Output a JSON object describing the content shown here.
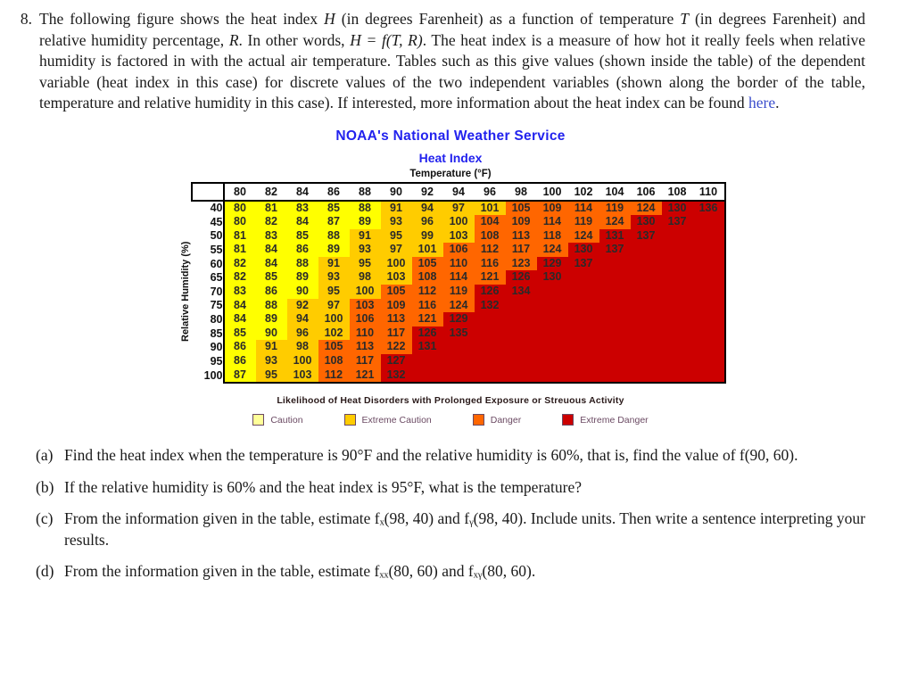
{
  "problem": {
    "number": "8.",
    "text_parts": [
      {
        "t": "The following figure shows the heat index "
      },
      {
        "t": "H",
        "style": "italic"
      },
      {
        "t": " (in degrees Farenheit) as a function of temperature "
      },
      {
        "t": "T",
        "style": "italic"
      },
      {
        "t": " (in degrees Farenheit) and relative humidity percentage, "
      },
      {
        "t": "R",
        "style": "italic"
      },
      {
        "t": ". In other words, "
      },
      {
        "t": "H = f(T, R)",
        "style": "italic"
      },
      {
        "t": ". The heat index is a measure of how hot it really feels when relative humidity is factored in with the actual air temperature. Tables such as this give values (shown inside the table) of the dependent variable (heat index in this case) for discrete values of the two independent variables (shown along the border of the table, temperature and relative humidity in this case). If interested, more information about the heat index can be found "
      },
      {
        "t": "here",
        "style": "link"
      },
      {
        "t": "."
      }
    ],
    "full_text": "The following figure shows the heat index H (in degrees Farenheit) as a function of temperature T (in degrees Farenheit) and relative humidity percentage, R. In other words, H = f(T, R). The heat index is a measure of how hot it really feels when relative humidity is factored in with the actual air temperature. Tables such as this give values (shown inside the table) of the dependent variable (heat index in this case) for discrete values of the two independent variables (shown along the border of the table, temperature and relative humidity in this case). If interested, more information about the heat index can be found here.",
    "link_text": "here",
    "link_color": "#3b4ecc"
  },
  "figure": {
    "org_title": "NOAA's National Weather Service",
    "chart_title": "Heat Index",
    "x_axis_title": "Temperature (°F)",
    "y_axis_title": "Relative Humidity (%)",
    "title_color": "#2222ee"
  },
  "chart_data": {
    "type": "heatmap",
    "title": "Heat Index",
    "subtitle": "NOAA's National Weather Service",
    "xlabel": "Temperature (°F)",
    "ylabel": "Relative Humidity (%)",
    "grid": false,
    "legend_position": "bottom",
    "x": [
      80,
      82,
      84,
      86,
      88,
      90,
      92,
      94,
      96,
      98,
      100,
      102,
      104,
      106,
      108,
      110
    ],
    "y": [
      40,
      45,
      50,
      55,
      60,
      65,
      70,
      75,
      80,
      85,
      90,
      95,
      100
    ],
    "values": [
      [
        80,
        81,
        83,
        85,
        88,
        91,
        94,
        97,
        101,
        105,
        109,
        114,
        119,
        124,
        130,
        136
      ],
      [
        80,
        82,
        84,
        87,
        89,
        93,
        96,
        100,
        104,
        109,
        114,
        119,
        124,
        130,
        137,
        null
      ],
      [
        81,
        83,
        85,
        88,
        91,
        95,
        99,
        103,
        108,
        113,
        118,
        124,
        131,
        137,
        null,
        null
      ],
      [
        81,
        84,
        86,
        89,
        93,
        97,
        101,
        106,
        112,
        117,
        124,
        130,
        137,
        null,
        null,
        null
      ],
      [
        82,
        84,
        88,
        91,
        95,
        100,
        105,
        110,
        116,
        123,
        129,
        137,
        null,
        null,
        null,
        null
      ],
      [
        82,
        85,
        89,
        93,
        98,
        103,
        108,
        114,
        121,
        126,
        130,
        null,
        null,
        null,
        null,
        null
      ],
      [
        83,
        86,
        90,
        95,
        100,
        105,
        112,
        119,
        126,
        134,
        null,
        null,
        null,
        null,
        null,
        null
      ],
      [
        84,
        88,
        92,
        97,
        103,
        109,
        116,
        124,
        132,
        null,
        null,
        null,
        null,
        null,
        null,
        null
      ],
      [
        84,
        89,
        94,
        100,
        106,
        113,
        121,
        129,
        null,
        null,
        null,
        null,
        null,
        null,
        null,
        null
      ],
      [
        85,
        90,
        96,
        102,
        110,
        117,
        126,
        135,
        null,
        null,
        null,
        null,
        null,
        null,
        null,
        null
      ],
      [
        86,
        91,
        98,
        105,
        113,
        122,
        131,
        null,
        null,
        null,
        null,
        null,
        null,
        null,
        null,
        null
      ],
      [
        86,
        93,
        100,
        108,
        117,
        127,
        null,
        null,
        null,
        null,
        null,
        null,
        null,
        null,
        null,
        null
      ],
      [
        87,
        95,
        103,
        112,
        121,
        132,
        null,
        null,
        null,
        null,
        null,
        null,
        null,
        null,
        null,
        null
      ]
    ],
    "categories_key": "caution | extreme-caution | danger | extreme-danger",
    "color_classes": [
      [
        "caution",
        "caution",
        "caution",
        "caution",
        "caution",
        "extreme-caution",
        "extreme-caution",
        "extreme-caution",
        "extreme-caution",
        "danger",
        "danger",
        "danger",
        "danger",
        "danger",
        "extreme-danger",
        "extreme-danger"
      ],
      [
        "caution",
        "caution",
        "caution",
        "caution",
        "caution",
        "extreme-caution",
        "extreme-caution",
        "extreme-caution",
        "danger",
        "danger",
        "danger",
        "danger",
        "danger",
        "extreme-danger",
        "extreme-danger",
        "extreme-danger"
      ],
      [
        "caution",
        "caution",
        "caution",
        "caution",
        "extreme-caution",
        "extreme-caution",
        "extreme-caution",
        "extreme-caution",
        "danger",
        "danger",
        "danger",
        "danger",
        "extreme-danger",
        "extreme-danger",
        "extreme-danger",
        "extreme-danger"
      ],
      [
        "caution",
        "caution",
        "caution",
        "caution",
        "extreme-caution",
        "extreme-caution",
        "extreme-caution",
        "danger",
        "danger",
        "danger",
        "danger",
        "extreme-danger",
        "extreme-danger",
        "extreme-danger",
        "extreme-danger",
        "extreme-danger"
      ],
      [
        "caution",
        "caution",
        "caution",
        "extreme-caution",
        "extreme-caution",
        "extreme-caution",
        "danger",
        "danger",
        "danger",
        "danger",
        "extreme-danger",
        "extreme-danger",
        "extreme-danger",
        "extreme-danger",
        "extreme-danger",
        "extreme-danger"
      ],
      [
        "caution",
        "caution",
        "caution",
        "extreme-caution",
        "extreme-caution",
        "extreme-caution",
        "danger",
        "danger",
        "danger",
        "extreme-danger",
        "extreme-danger",
        "extreme-danger",
        "extreme-danger",
        "extreme-danger",
        "extreme-danger",
        "extreme-danger"
      ],
      [
        "caution",
        "caution",
        "caution",
        "extreme-caution",
        "extreme-caution",
        "danger",
        "danger",
        "danger",
        "extreme-danger",
        "extreme-danger",
        "extreme-danger",
        "extreme-danger",
        "extreme-danger",
        "extreme-danger",
        "extreme-danger",
        "extreme-danger"
      ],
      [
        "caution",
        "caution",
        "extreme-caution",
        "extreme-caution",
        "danger",
        "danger",
        "danger",
        "danger",
        "extreme-danger",
        "extreme-danger",
        "extreme-danger",
        "extreme-danger",
        "extreme-danger",
        "extreme-danger",
        "extreme-danger",
        "extreme-danger"
      ],
      [
        "caution",
        "caution",
        "extreme-caution",
        "extreme-caution",
        "danger",
        "danger",
        "danger",
        "extreme-danger",
        "extreme-danger",
        "extreme-danger",
        "extreme-danger",
        "extreme-danger",
        "extreme-danger",
        "extreme-danger",
        "extreme-danger",
        "extreme-danger"
      ],
      [
        "caution",
        "caution",
        "extreme-caution",
        "extreme-caution",
        "danger",
        "danger",
        "extreme-danger",
        "extreme-danger",
        "extreme-danger",
        "extreme-danger",
        "extreme-danger",
        "extreme-danger",
        "extreme-danger",
        "extreme-danger",
        "extreme-danger",
        "extreme-danger"
      ],
      [
        "caution",
        "extreme-caution",
        "extreme-caution",
        "danger",
        "danger",
        "danger",
        "extreme-danger",
        "extreme-danger",
        "extreme-danger",
        "extreme-danger",
        "extreme-danger",
        "extreme-danger",
        "extreme-danger",
        "extreme-danger",
        "extreme-danger",
        "extreme-danger"
      ],
      [
        "caution",
        "extreme-caution",
        "extreme-caution",
        "danger",
        "danger",
        "extreme-danger",
        "extreme-danger",
        "extreme-danger",
        "extreme-danger",
        "extreme-danger",
        "extreme-danger",
        "extreme-danger",
        "extreme-danger",
        "extreme-danger",
        "extreme-danger",
        "extreme-danger"
      ],
      [
        "caution",
        "extreme-caution",
        "extreme-caution",
        "danger",
        "danger",
        "extreme-danger",
        "extreme-danger",
        "extreme-danger",
        "extreme-danger",
        "extreme-danger",
        "extreme-danger",
        "extreme-danger",
        "extreme-danger",
        "extreme-danger",
        "extreme-danger",
        "extreme-danger"
      ]
    ]
  },
  "legend": {
    "caption": "Likelihood of Heat Disorders with Prolonged Exposure or Streuous Activity",
    "text_color": "#6b4a63",
    "items": [
      {
        "label": "Caution",
        "color": "#FFFF99",
        "key": "caution"
      },
      {
        "label": "Extreme Caution",
        "color": "#FFCC00",
        "key": "extreme-caution"
      },
      {
        "label": "Danger",
        "color": "#FF6600",
        "key": "danger"
      },
      {
        "label": "Extreme Danger",
        "color": "#CC0000",
        "key": "extreme-danger"
      }
    ]
  },
  "parts": [
    {
      "label": "(a)",
      "text": "Find the heat index when the temperature is 90°F and the relative humidity is 60%, that is, find the value of f(90, 60)."
    },
    {
      "label": "(b)",
      "text": "If the relative humidity is 60% and the heat index is 95°F, what is the temperature?"
    },
    {
      "label": "(c)",
      "text": "From the information given in the table, estimate fₓ(98, 40) and fᵧ(98, 40). Include units. Then write a sentence interpreting your results."
    },
    {
      "label": "(d)",
      "text": "From the information given in the table, estimate fₓₓ(80, 60) and fₓᵧ(80, 60)."
    }
  ]
}
